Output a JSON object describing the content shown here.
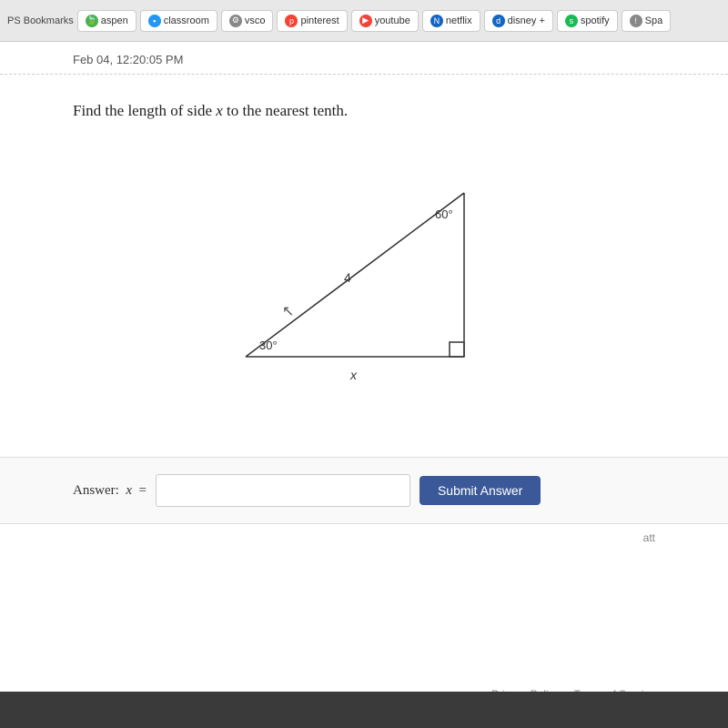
{
  "browser": {
    "bookmarks_label": "PS Bookmarks",
    "tabs": [
      {
        "label": "aspen",
        "icon_type": "green",
        "icon_char": "a"
      },
      {
        "label": "classroom",
        "icon_type": "blue",
        "icon_char": "▪"
      },
      {
        "label": "vsco",
        "icon_type": "gray",
        "icon_char": "⚙"
      },
      {
        "label": "pinterest",
        "icon_type": "red",
        "icon_char": "p"
      },
      {
        "label": "youtube",
        "icon_type": "red",
        "icon_char": "▶"
      },
      {
        "label": "netflix",
        "icon_type": "red",
        "icon_char": "N"
      },
      {
        "label": "disney +",
        "icon_type": "darkblue",
        "icon_char": "d"
      },
      {
        "label": "spotify",
        "icon_type": "spotify-green",
        "icon_char": "s"
      },
      {
        "label": "Spa",
        "icon_type": "gray",
        "icon_char": "!"
      }
    ]
  },
  "timestamp": "Feb 04, 12:20:05 PM",
  "question": {
    "text_before": "Find the length of side ",
    "variable": "x",
    "text_after": " to the nearest tenth.",
    "angle1": "60°",
    "angle2": "30°",
    "angle3": "90°",
    "side_label": "4",
    "bottom_label": "x"
  },
  "answer": {
    "label": "Answer:",
    "variable": "x",
    "equals": "=",
    "input_placeholder": "",
    "button_label": "Submit Answer"
  },
  "footer": {
    "att_label": "att",
    "privacy_label": "Privacy Policy",
    "terms_label": "Terms of Service"
  }
}
